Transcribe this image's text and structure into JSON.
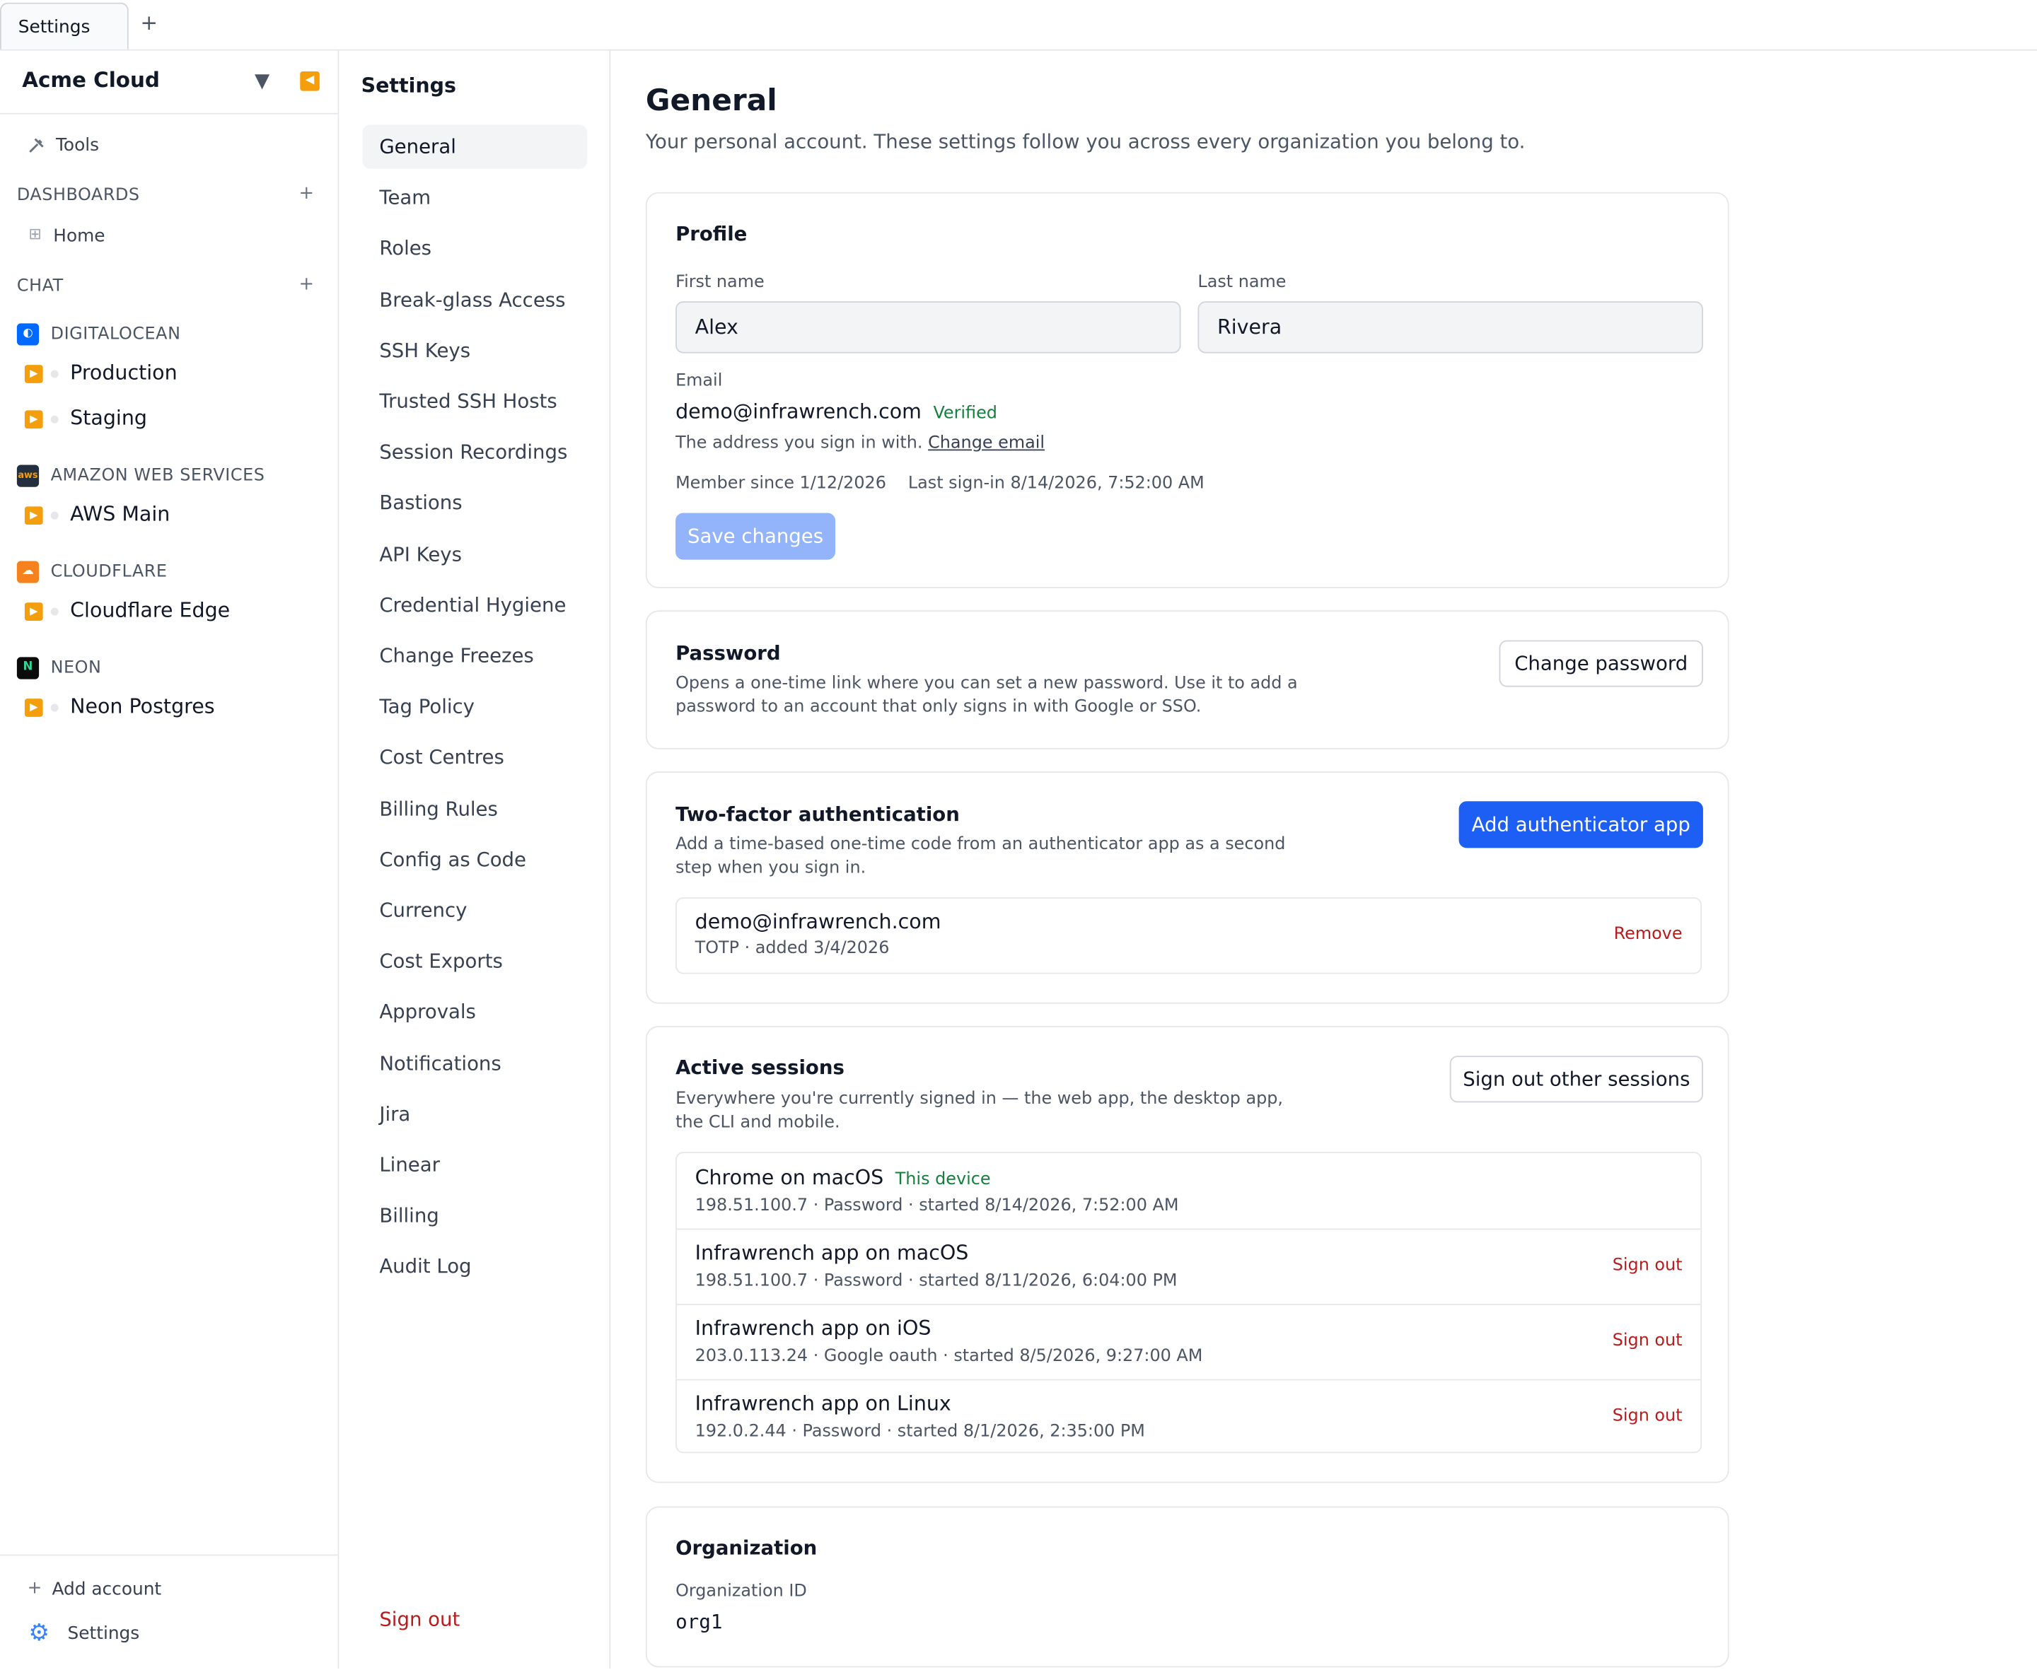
{
  "tabbar": {
    "tab_label": "Settings",
    "new_tab": "+"
  },
  "sidebar": {
    "account_name": "Acme Cloud",
    "caret": "▼",
    "collapse": "◀",
    "tools_label": "Tools",
    "dashboards_header": "DASHBOARDS",
    "dashboards_add": "+",
    "home_label": "Home",
    "chat_header": "CHAT",
    "chat_add": "+",
    "providers": [
      {
        "name": "DIGITALOCEAN",
        "color": "#0069ff",
        "envs": [
          "Production",
          "Staging"
        ]
      },
      {
        "name": "AMAZON WEB SERVICES",
        "color": "#232f3e",
        "envs": [
          "AWS Main"
        ]
      },
      {
        "name": "CLOUDFLARE",
        "color": "#f6821f",
        "envs": [
          "Cloudflare Edge"
        ]
      },
      {
        "name": "NEON",
        "color": "#0b0b0b",
        "envs": [
          "Neon Postgres"
        ]
      }
    ],
    "add_account": "Add account",
    "settings_label": "Settings"
  },
  "settings_nav": {
    "title": "Settings",
    "items": [
      "General",
      "Team",
      "Roles",
      "Break-glass Access",
      "SSH Keys",
      "Trusted SSH Hosts",
      "Session Recordings",
      "Bastions",
      "API Keys",
      "Credential Hygiene",
      "Change Freezes",
      "Tag Policy",
      "Cost Centres",
      "Billing Rules",
      "Config as Code",
      "Currency",
      "Cost Exports",
      "Approvals",
      "Notifications",
      "Jira",
      "Linear",
      "Billing",
      "Audit Log"
    ],
    "active": "General",
    "sign_out": "Sign out"
  },
  "main": {
    "title": "General",
    "subtitle": "Your personal account. These settings follow you across every organization you belong to.",
    "profile": {
      "title": "Profile",
      "first_name_label": "First name",
      "first_name": "Alex",
      "last_name_label": "Last name",
      "last_name": "Rivera",
      "email_label": "Email",
      "email": "demo@infrawrench.com",
      "verified": "Verified",
      "email_hint": "The address you sign in with.",
      "change_email": "Change email",
      "member_since": "Member since 1/12/2026",
      "last_signin": "Last sign-in 8/14/2026, 7:52:00 AM",
      "save": "Save changes"
    },
    "password": {
      "title": "Password",
      "desc": "Opens a one-time link where you can set a new password. Use it to add a password to an account that only signs in with Google or SSO.",
      "button": "Change password"
    },
    "two_factor": {
      "title": "Two-factor authentication",
      "desc": "Add a time-based one-time code from an authenticator app as a second step when you sign in.",
      "button": "Add authenticator app",
      "device_email": "demo@infrawrench.com",
      "device_meta": "TOTP · added 3/4/2026",
      "remove": "Remove"
    },
    "sessions": {
      "title": "Active sessions",
      "desc": "Everywhere you're currently signed in — the web app, the desktop app, the CLI and mobile.",
      "button": "Sign out other sessions",
      "rows": [
        {
          "title": "Chrome on macOS",
          "badge": "This device",
          "meta": "198.51.100.7 · Password · started 8/14/2026, 7:52:00 AM",
          "action": ""
        },
        {
          "title": "Infrawrench app on macOS",
          "badge": "",
          "meta": "198.51.100.7 · Password · started 8/11/2026, 6:04:00 PM",
          "action": "Sign out"
        },
        {
          "title": "Infrawrench app on iOS",
          "badge": "",
          "meta": "203.0.113.24 · Google oauth · started 8/5/2026, 9:27:00 AM",
          "action": "Sign out"
        },
        {
          "title": "Infrawrench app on Linux",
          "badge": "",
          "meta": "192.0.2.44 · Password · started 8/1/2026, 2:35:00 PM",
          "action": "Sign out"
        }
      ]
    },
    "organization": {
      "title": "Organization",
      "id_label": "Organization ID",
      "id": "org1"
    }
  }
}
